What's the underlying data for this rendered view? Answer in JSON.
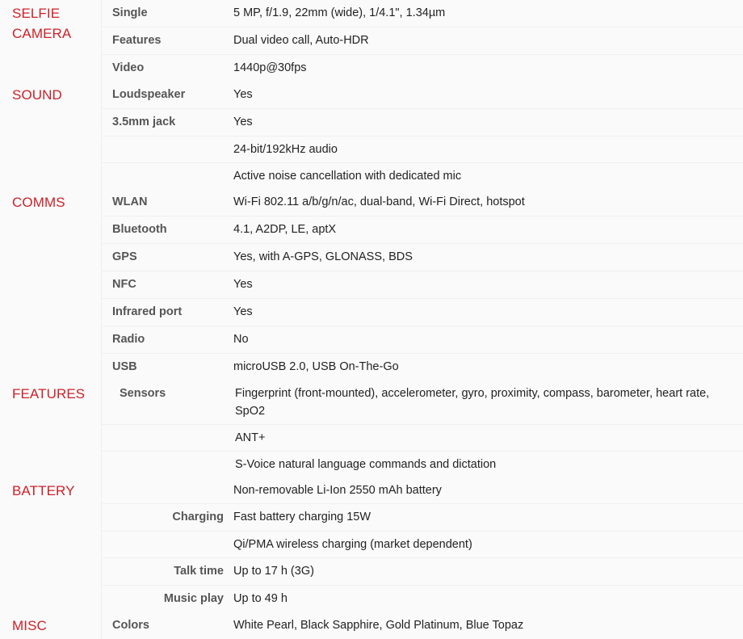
{
  "page": {
    "type": "phone-specification-table",
    "accent_color": "#cc2229",
    "label_color": "#555555",
    "value_color": "#222222",
    "background_color": "#fafafa"
  },
  "sections": [
    {
      "title": "SELFIE CAMERA",
      "rows": [
        {
          "label": "Single",
          "value": "5 MP, f/1.9, 22mm (wide), 1/4.1\", 1.34µm"
        },
        {
          "label": "Features",
          "value": "Dual video call, Auto-HDR"
        },
        {
          "label": "Video",
          "value": "1440p@30fps"
        }
      ]
    },
    {
      "title": "SOUND",
      "rows": [
        {
          "label": "Loudspeaker",
          "value": "Yes"
        },
        {
          "label": "3.5mm jack",
          "value": "Yes"
        },
        {
          "label": "",
          "value": "24-bit/192kHz audio"
        },
        {
          "label": "",
          "value": "Active noise cancellation with dedicated mic"
        }
      ]
    },
    {
      "title": "COMMS",
      "rows": [
        {
          "label": "WLAN",
          "value": "Wi-Fi 802.11 a/b/g/n/ac, dual-band, Wi-Fi Direct, hotspot"
        },
        {
          "label": "Bluetooth",
          "value": "4.1, A2DP, LE, aptX"
        },
        {
          "label": "GPS",
          "value": "Yes, with A-GPS, GLONASS, BDS"
        },
        {
          "label": "NFC",
          "value": "Yes"
        },
        {
          "label": "Infrared port",
          "value": "Yes"
        },
        {
          "label": "Radio",
          "value": "No"
        },
        {
          "label": "USB",
          "value": "microUSB 2.0, USB On-The-Go"
        }
      ]
    },
    {
      "title": "FEATURES",
      "rows": [
        {
          "label": "Sensors",
          "value": "Fingerprint (front-mounted), accelerometer, gyro, proximity, compass, barometer, heart rate, SpO2"
        },
        {
          "label": "",
          "value": "ANT+"
        },
        {
          "label": "",
          "value": "S-Voice natural language commands and dictation"
        }
      ]
    },
    {
      "title": "BATTERY",
      "rows": [
        {
          "label": "",
          "value": "Non-removable Li-Ion 2550 mAh battery"
        },
        {
          "label": "Charging",
          "value": "Fast battery charging 15W"
        },
        {
          "label": "",
          "value": "Qi/PMA wireless charging (market dependent)"
        },
        {
          "label": "Talk time",
          "value": "Up to 17 h (3G)"
        },
        {
          "label": "Music play",
          "value": "Up to 49 h"
        }
      ]
    },
    {
      "title": "MISC",
      "rows": [
        {
          "label": "Colors",
          "value": "White Pearl, Black Sapphire, Gold Platinum, Blue Topaz"
        }
      ]
    }
  ]
}
